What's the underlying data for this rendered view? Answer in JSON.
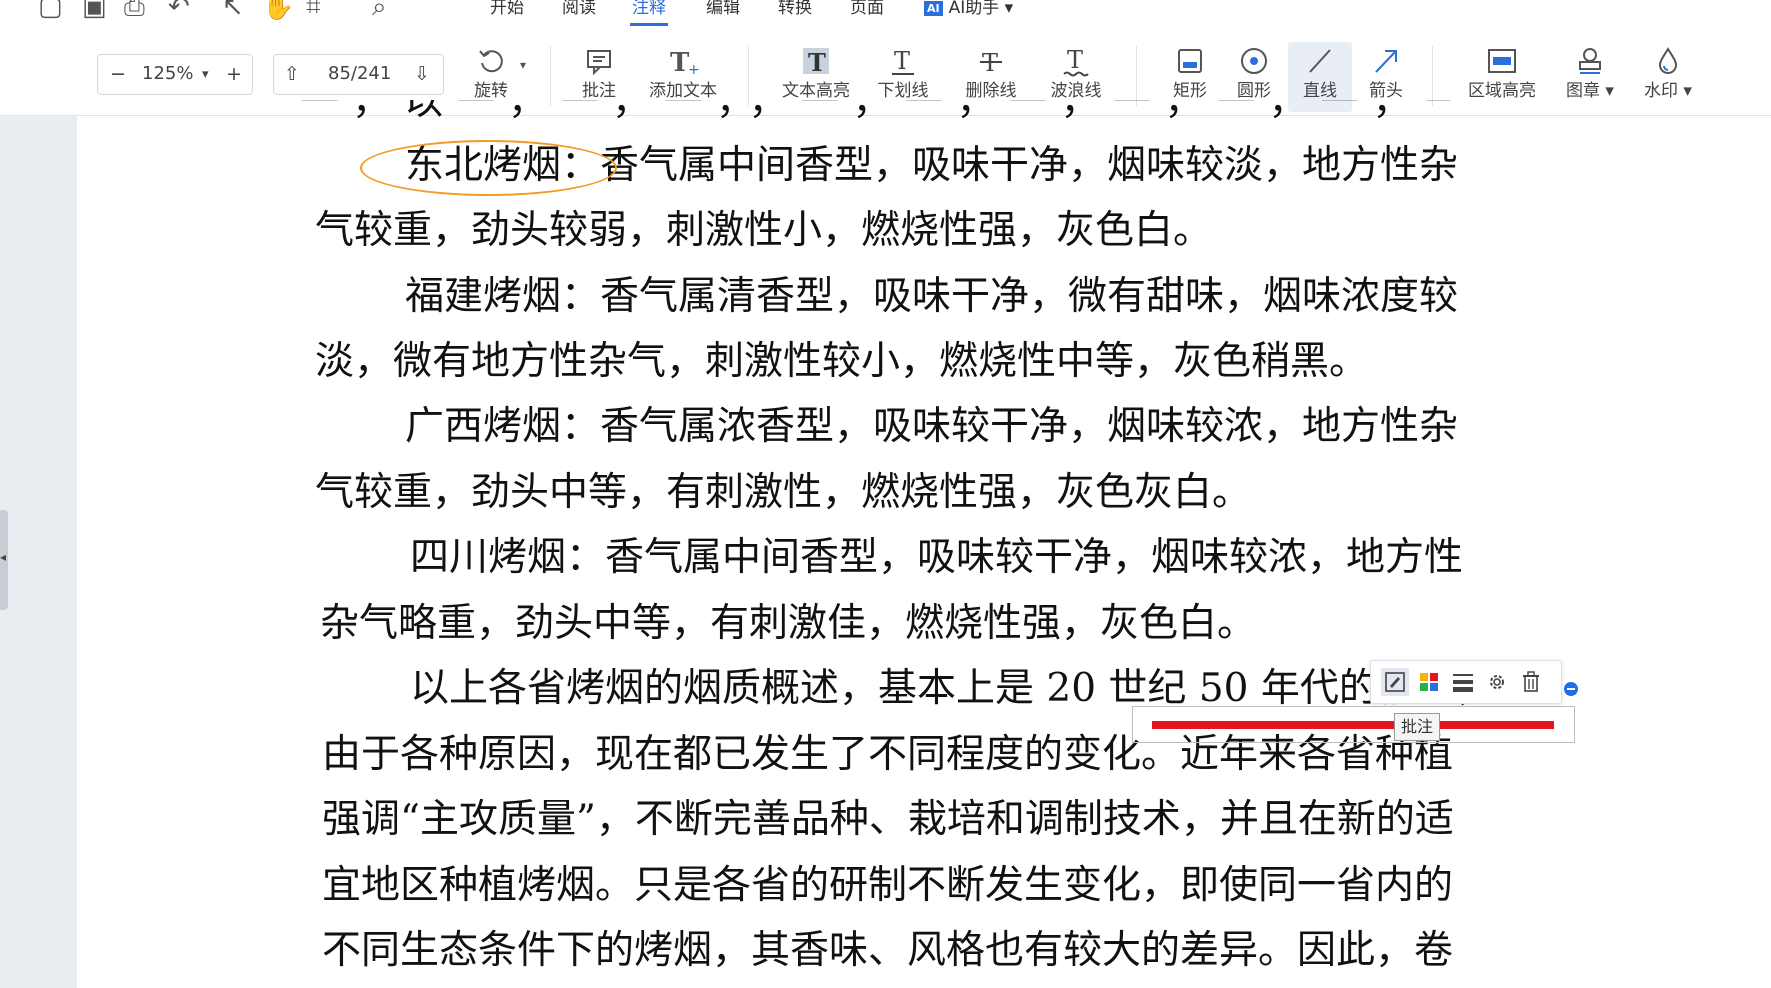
{
  "menubar": {
    "items": [
      "开始",
      "阅读",
      "注释",
      "编辑",
      "转换",
      "页面"
    ],
    "ai_badge": "AI",
    "ai_label": "AI助手 ▾"
  },
  "toolbar": {
    "zoom": {
      "minus": "−",
      "value": "125%",
      "caret": "▾",
      "plus": "+"
    },
    "page": {
      "up": "⇧",
      "value": "85/241",
      "down": "⇩"
    },
    "rotate": "旋转",
    "tools": [
      "批注",
      "添加文本",
      "文本高亮",
      "下划线",
      "删除线",
      "波浪线",
      "矩形",
      "圆形",
      "直线",
      "箭头",
      "区域高亮",
      "图章 ▾",
      "水印 ▾"
    ]
  },
  "document": {
    "lines": [
      "东北烤烟：香气属中间香型，吸味干净，烟味较淡，地方性杂",
      "气较重，劲头较弱，刺激性小，燃烧性强，灰色白。",
      "福建烤烟：香气属清香型，吸味干净，微有甜味，烟味浓度较",
      "淡，微有地方性杂气，刺激性较小，燃烧性中等，灰色稍黑。",
      "广西烤烟：香气属浓香型，吸味较干净，烟味较浓，地方性杂",
      "气较重，劲头中等，有刺激性，燃烧性强，灰色灰白。",
      "四川烤烟：香气属中间香型，吸味较干净，烟味较浓，地方性",
      "杂气略重，劲头中等，有刺激佳，燃烧性强，灰色白。",
      "以上各省烤烟的烟质概述，基本上是 20 世纪 50 年代的情况，",
      "由于各种原因，现在都已发生了不同程度的变化。近年来各省种植",
      "强调“主攻质量”，不断完善品种、栽培和调制技术，并且在新的适",
      "宜地区种植烤烟。只是各省的研制不断发生变化，即使同一省内的",
      "不同生态条件下的烤烟，其香味、风格也有较大的差异。因此，卷"
    ],
    "partial_top": "一，以一，一，一，，一，一，一，一，一，一，一"
  },
  "annotation_popup": {
    "tooltip": "批注"
  },
  "colors": {
    "accent": "#2a6fdb",
    "ellipse": "#f59a23",
    "underline": "#e8141b"
  }
}
